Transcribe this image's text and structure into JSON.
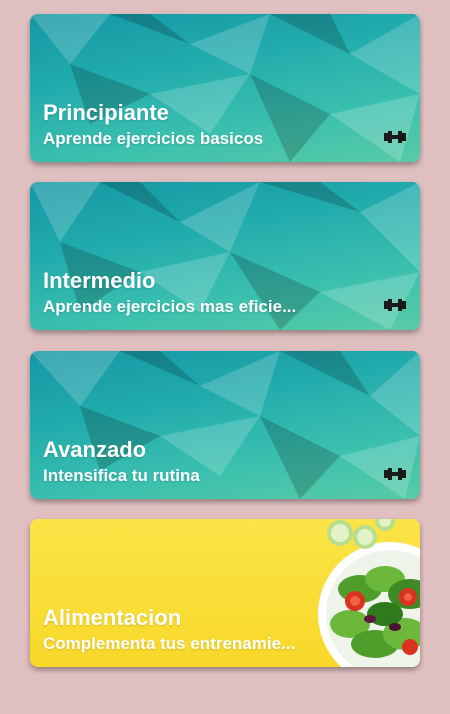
{
  "cards": [
    {
      "title": "Principiante",
      "subtitle": "Aprende ejercicios basicos",
      "icon": "dumbbell-icon"
    },
    {
      "title": "Intermedio",
      "subtitle": "Aprende ejercicios mas eficie...",
      "icon": "dumbbell-icon"
    },
    {
      "title": "Avanzado",
      "subtitle": "Intensifica tu rutina",
      "icon": "dumbbell-icon"
    },
    {
      "title": "Alimentacion",
      "subtitle": "Complementa tus entrenamie...",
      "icon": "salad-image"
    }
  ],
  "colors": {
    "background": "#e0bfc0",
    "card_teal": "#1fa8ad",
    "card_yellow": "#f9dd2a",
    "text": "#ffffff"
  }
}
